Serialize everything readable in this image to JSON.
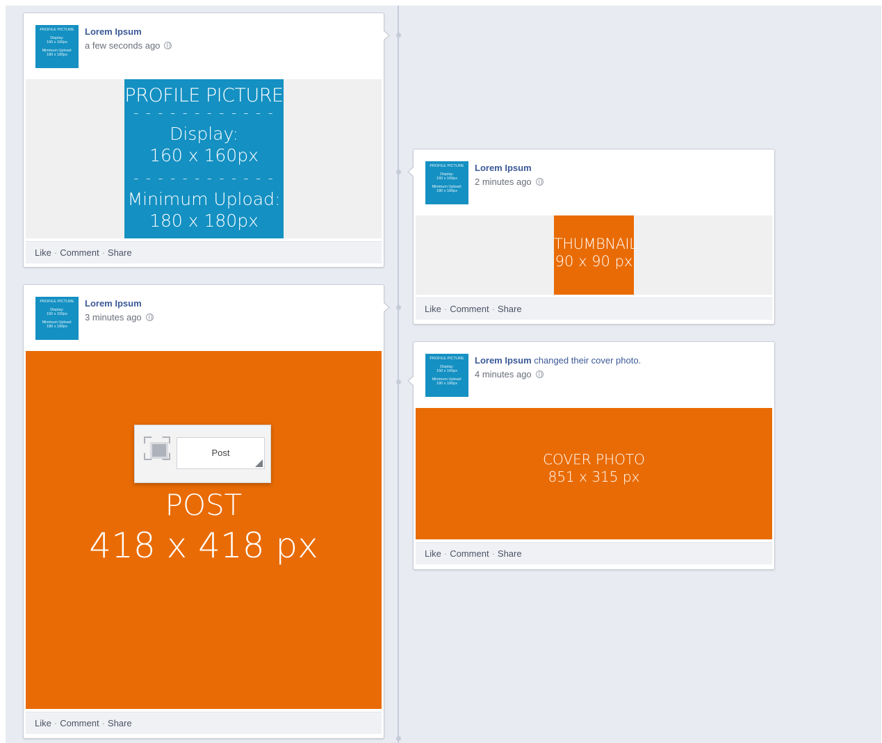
{
  "colors": {
    "page_bg": "#e9ebf2",
    "card_bg": "#ffffff",
    "link_blue": "#3b5998",
    "profile_blue": "#1490c2",
    "orange": "#e96b05"
  },
  "avatar": {
    "line1": "PROFILE PICTURE",
    "line2": "Display:",
    "line3": "160 x 160px",
    "line4": "Minimum Upload:",
    "line5": "180 x 180px"
  },
  "footer": {
    "like": "Like",
    "comment": "Comment",
    "share": "Share",
    "separator": "·"
  },
  "posts": [
    {
      "author": "Lorem Ipsum",
      "action": "",
      "time": "a few seconds ago",
      "image": {
        "title": "PROFILE PICTURE",
        "dashes": "- - - - - - - - - - - -",
        "display_label": "Display:",
        "display_size": "160 x 160px",
        "upload_label": "Minimum Upload:",
        "upload_size": "180 x 180px"
      }
    },
    {
      "author": "Lorem Ipsum",
      "action": "",
      "time": "3 minutes ago",
      "image": {
        "composer_placeholder": "Post",
        "title": "POST",
        "size": "418 x 418 px"
      }
    },
    {
      "author": "Lorem Ipsum",
      "action": "",
      "time": "2 minutes ago",
      "image": {
        "title": "THUMBNAIL",
        "size": "90 x 90 px"
      }
    },
    {
      "author": "Lorem Ipsum",
      "action": "changed their cover photo.",
      "time": "4 minutes ago",
      "image": {
        "title": "COVER PHOTO",
        "size": "851 x 315 px"
      }
    }
  ]
}
